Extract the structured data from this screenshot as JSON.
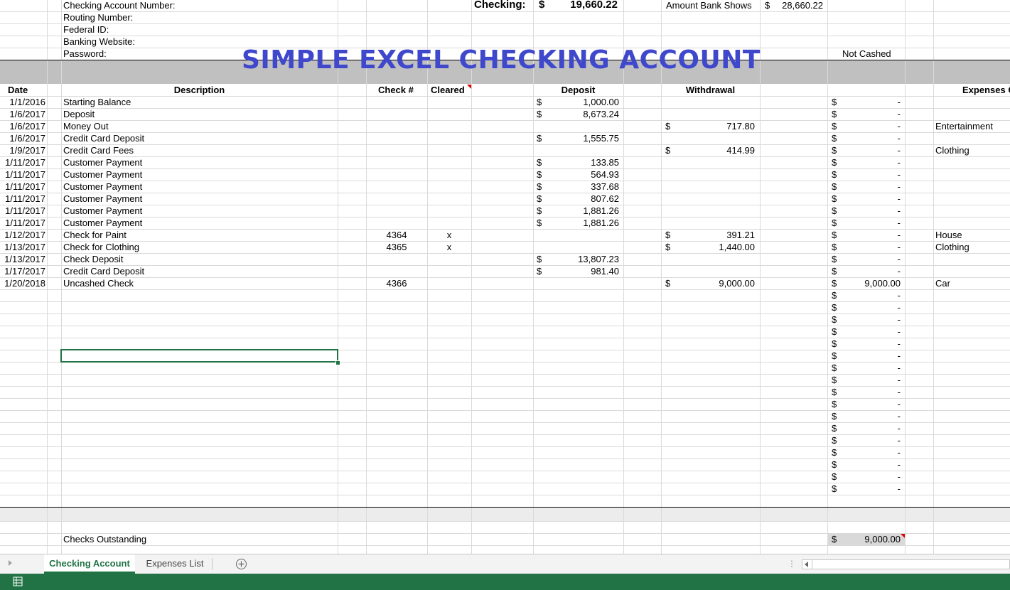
{
  "info": {
    "account_number_label": "Checking Account Number:",
    "routing_label": "Routing Number:",
    "federal_id_label": "Federal ID:",
    "website_label": "Banking Website:",
    "password_label": "Password:",
    "checking_label": "Checking:",
    "checking_currency": "$",
    "checking_value": "19,660.22",
    "bank_shows_label": "Amount Bank Shows",
    "bank_shows_currency": "$",
    "bank_shows_value": "28,660.22",
    "not_cashed_label": "Not Cashed"
  },
  "title": "SIMPLE EXCEL CHECKING ACCOUNT",
  "headers": {
    "date": "Date",
    "description": "Description",
    "check": "Check #",
    "cleared": "Cleared",
    "deposit": "Deposit",
    "withdrawal": "Withdrawal",
    "expenses": "Expenses C"
  },
  "rows": [
    {
      "date": "1/1/2016",
      "desc": "Starting Balance",
      "check": "",
      "cleared": "",
      "dep_cur": "$",
      "deposit": "1,000.00",
      "wd_cur": "",
      "withdrawal": "",
      "nc_cur": "$",
      "not_cashed": "-",
      "category": ""
    },
    {
      "date": "1/6/2017",
      "desc": "Deposit",
      "check": "",
      "cleared": "",
      "dep_cur": "$",
      "deposit": "8,673.24",
      "wd_cur": "",
      "withdrawal": "",
      "nc_cur": "$",
      "not_cashed": "-",
      "category": ""
    },
    {
      "date": "1/6/2017",
      "desc": "Money Out",
      "check": "",
      "cleared": "",
      "dep_cur": "",
      "deposit": "",
      "wd_cur": "$",
      "withdrawal": "717.80",
      "nc_cur": "$",
      "not_cashed": "-",
      "category": "Entertainment"
    },
    {
      "date": "1/6/2017",
      "desc": "Credit Card Deposit",
      "check": "",
      "cleared": "",
      "dep_cur": "$",
      "deposit": "1,555.75",
      "wd_cur": "",
      "withdrawal": "",
      "nc_cur": "$",
      "not_cashed": "-",
      "category": ""
    },
    {
      "date": "1/9/2017",
      "desc": "Credit Card Fees",
      "check": "",
      "cleared": "",
      "dep_cur": "",
      "deposit": "",
      "wd_cur": "$",
      "withdrawal": "414.99",
      "nc_cur": "$",
      "not_cashed": "-",
      "category": "Clothing"
    },
    {
      "date": "1/11/2017",
      "desc": "Customer Payment",
      "check": "",
      "cleared": "",
      "dep_cur": "$",
      "deposit": "133.85",
      "wd_cur": "",
      "withdrawal": "",
      "nc_cur": "$",
      "not_cashed": "-",
      "category": ""
    },
    {
      "date": "1/11/2017",
      "desc": "Customer Payment",
      "check": "",
      "cleared": "",
      "dep_cur": "$",
      "deposit": "564.93",
      "wd_cur": "",
      "withdrawal": "",
      "nc_cur": "$",
      "not_cashed": "-",
      "category": ""
    },
    {
      "date": "1/11/2017",
      "desc": "Customer Payment",
      "check": "",
      "cleared": "",
      "dep_cur": "$",
      "deposit": "337.68",
      "wd_cur": "",
      "withdrawal": "",
      "nc_cur": "$",
      "not_cashed": "-",
      "category": ""
    },
    {
      "date": "1/11/2017",
      "desc": "Customer Payment",
      "check": "",
      "cleared": "",
      "dep_cur": "$",
      "deposit": "807.62",
      "wd_cur": "",
      "withdrawal": "",
      "nc_cur": "$",
      "not_cashed": "-",
      "category": ""
    },
    {
      "date": "1/11/2017",
      "desc": "Customer Payment",
      "check": "",
      "cleared": "",
      "dep_cur": "$",
      "deposit": "1,881.26",
      "wd_cur": "",
      "withdrawal": "",
      "nc_cur": "$",
      "not_cashed": "-",
      "category": ""
    },
    {
      "date": "1/11/2017",
      "desc": "Customer Payment",
      "check": "",
      "cleared": "",
      "dep_cur": "$",
      "deposit": "1,881.26",
      "wd_cur": "",
      "withdrawal": "",
      "nc_cur": "$",
      "not_cashed": "-",
      "category": ""
    },
    {
      "date": "1/12/2017",
      "desc": "Check for Paint",
      "check": "4364",
      "cleared": "x",
      "dep_cur": "",
      "deposit": "",
      "wd_cur": "$",
      "withdrawal": "391.21",
      "nc_cur": "$",
      "not_cashed": "-",
      "category": "House"
    },
    {
      "date": "1/13/2017",
      "desc": "Check for Clothing",
      "check": "4365",
      "cleared": "x",
      "dep_cur": "",
      "deposit": "",
      "wd_cur": "$",
      "withdrawal": "1,440.00",
      "nc_cur": "$",
      "not_cashed": "-",
      "category": "Clothing"
    },
    {
      "date": "1/13/2017",
      "desc": "Check Deposit",
      "check": "",
      "cleared": "",
      "dep_cur": "$",
      "deposit": "13,807.23",
      "wd_cur": "",
      "withdrawal": "",
      "nc_cur": "$",
      "not_cashed": "-",
      "category": ""
    },
    {
      "date": "1/17/2017",
      "desc": "Credit Card Deposit",
      "check": "",
      "cleared": "",
      "dep_cur": "$",
      "deposit": "981.40",
      "wd_cur": "",
      "withdrawal": "",
      "nc_cur": "$",
      "not_cashed": "-",
      "category": ""
    },
    {
      "date": "1/20/2018",
      "desc": "Uncashed Check",
      "check": "4366",
      "cleared": "",
      "dep_cur": "",
      "deposit": "",
      "wd_cur": "$",
      "withdrawal": "9,000.00",
      "nc_cur": "$",
      "not_cashed": "9,000.00",
      "category": "Car"
    },
    {
      "date": "",
      "desc": "",
      "check": "",
      "cleared": "",
      "dep_cur": "",
      "deposit": "",
      "wd_cur": "",
      "withdrawal": "",
      "nc_cur": "$",
      "not_cashed": "-",
      "category": ""
    },
    {
      "date": "",
      "desc": "",
      "check": "",
      "cleared": "",
      "dep_cur": "",
      "deposit": "",
      "wd_cur": "",
      "withdrawal": "",
      "nc_cur": "$",
      "not_cashed": "-",
      "category": ""
    },
    {
      "date": "",
      "desc": "",
      "check": "",
      "cleared": "",
      "dep_cur": "",
      "deposit": "",
      "wd_cur": "",
      "withdrawal": "",
      "nc_cur": "$",
      "not_cashed": "-",
      "category": ""
    },
    {
      "date": "",
      "desc": "",
      "check": "",
      "cleared": "",
      "dep_cur": "",
      "deposit": "",
      "wd_cur": "",
      "withdrawal": "",
      "nc_cur": "$",
      "not_cashed": "-",
      "category": ""
    },
    {
      "date": "",
      "desc": "",
      "check": "",
      "cleared": "",
      "dep_cur": "",
      "deposit": "",
      "wd_cur": "",
      "withdrawal": "",
      "nc_cur": "$",
      "not_cashed": "-",
      "category": ""
    },
    {
      "date": "",
      "desc": "",
      "check": "",
      "cleared": "",
      "dep_cur": "",
      "deposit": "",
      "wd_cur": "",
      "withdrawal": "",
      "nc_cur": "$",
      "not_cashed": "-",
      "category": ""
    },
    {
      "date": "",
      "desc": "",
      "check": "",
      "cleared": "",
      "dep_cur": "",
      "deposit": "",
      "wd_cur": "",
      "withdrawal": "",
      "nc_cur": "$",
      "not_cashed": "-",
      "category": ""
    },
    {
      "date": "",
      "desc": "",
      "check": "",
      "cleared": "",
      "dep_cur": "",
      "deposit": "",
      "wd_cur": "",
      "withdrawal": "",
      "nc_cur": "$",
      "not_cashed": "-",
      "category": ""
    },
    {
      "date": "",
      "desc": "",
      "check": "",
      "cleared": "",
      "dep_cur": "",
      "deposit": "",
      "wd_cur": "",
      "withdrawal": "",
      "nc_cur": "$",
      "not_cashed": "-",
      "category": ""
    },
    {
      "date": "",
      "desc": "",
      "check": "",
      "cleared": "",
      "dep_cur": "",
      "deposit": "",
      "wd_cur": "",
      "withdrawal": "",
      "nc_cur": "$",
      "not_cashed": "-",
      "category": ""
    },
    {
      "date": "",
      "desc": "",
      "check": "",
      "cleared": "",
      "dep_cur": "",
      "deposit": "",
      "wd_cur": "",
      "withdrawal": "",
      "nc_cur": "$",
      "not_cashed": "-",
      "category": ""
    },
    {
      "date": "",
      "desc": "",
      "check": "",
      "cleared": "",
      "dep_cur": "",
      "deposit": "",
      "wd_cur": "",
      "withdrawal": "",
      "nc_cur": "$",
      "not_cashed": "-",
      "category": ""
    },
    {
      "date": "",
      "desc": "",
      "check": "",
      "cleared": "",
      "dep_cur": "",
      "deposit": "",
      "wd_cur": "",
      "withdrawal": "",
      "nc_cur": "$",
      "not_cashed": "-",
      "category": ""
    },
    {
      "date": "",
      "desc": "",
      "check": "",
      "cleared": "",
      "dep_cur": "",
      "deposit": "",
      "wd_cur": "",
      "withdrawal": "",
      "nc_cur": "$",
      "not_cashed": "-",
      "category": ""
    },
    {
      "date": "",
      "desc": "",
      "check": "",
      "cleared": "",
      "dep_cur": "",
      "deposit": "",
      "wd_cur": "",
      "withdrawal": "",
      "nc_cur": "$",
      "not_cashed": "-",
      "category": ""
    },
    {
      "date": "",
      "desc": "",
      "check": "",
      "cleared": "",
      "dep_cur": "",
      "deposit": "",
      "wd_cur": "",
      "withdrawal": "",
      "nc_cur": "$",
      "not_cashed": "-",
      "category": ""
    },
    {
      "date": "",
      "desc": "",
      "check": "",
      "cleared": "",
      "dep_cur": "",
      "deposit": "",
      "wd_cur": "",
      "withdrawal": "",
      "nc_cur": "$",
      "not_cashed": "-",
      "category": ""
    }
  ],
  "footer": {
    "checks_outstanding_label": "Checks Outstanding",
    "checks_outstanding_currency": "$",
    "checks_outstanding_value": "9,000.00"
  },
  "tabs": [
    {
      "label": "Checking Account",
      "active": true
    },
    {
      "label": "Expenses List",
      "active": false
    }
  ],
  "colors": {
    "title": "#3f48cc",
    "excel_green": "#217346",
    "band_gray": "#c0c0c0"
  }
}
